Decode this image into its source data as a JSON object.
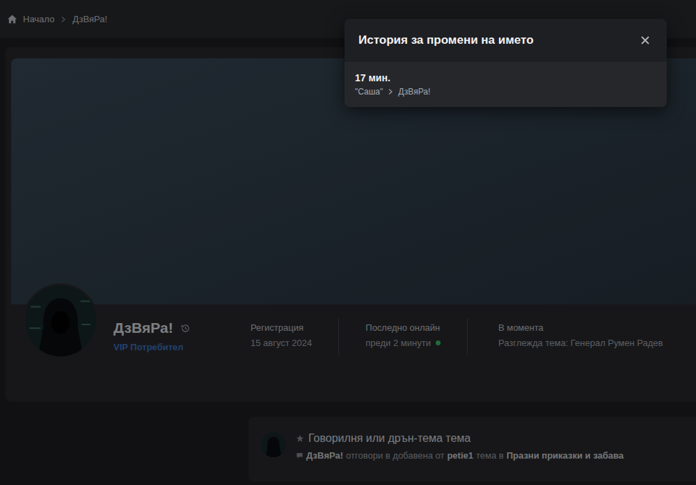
{
  "breadcrumb": [
    "Начало",
    "ДзВяРа!"
  ],
  "profile": {
    "name": "ДзВяРа!",
    "role": "VIP Потребител",
    "stats": [
      {
        "label": "Регистрация",
        "value": "15 август 2024",
        "online": false
      },
      {
        "label": "Последно онлайн",
        "value": "преди 2 минути",
        "online": true
      },
      {
        "label": "В момента",
        "value": "Разглежда тема: Генерал Румен Радев",
        "online": false
      }
    ]
  },
  "activity": [
    {
      "title": "Говорилня или дрън-тема тема",
      "parts": [
        {
          "text": "ДзВяРа!",
          "strong": true
        },
        {
          "text": "отговори в добавена от",
          "strong": false
        },
        {
          "text": "petie1",
          "strong": true
        },
        {
          "text": "тема в",
          "strong": false
        },
        {
          "text": "Празни приказки и забава",
          "strong": true
        }
      ]
    }
  ],
  "dialog": {
    "title": "История за промени на името",
    "entries": [
      {
        "time": "17 мин.",
        "from": "\"Саша\"",
        "to": "ДзВяРа!"
      }
    ]
  }
}
